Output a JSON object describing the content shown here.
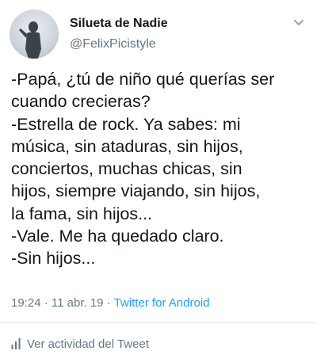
{
  "tweet": {
    "author": {
      "display_name": "Silueta de Nadie",
      "handle": "@FelixPicistyle",
      "avatar_icon": "silhouette-avatar"
    },
    "menu_icon": "chevron-down-icon",
    "text_lines": [
      "-Papá, ¿tú de niño qué querías ser",
      "cuando crecieras?",
      "-Estrella de rock. Ya sabes: mi",
      "música, sin ataduras, sin hijos,",
      "conciertos, muchas chicas, sin",
      "hijos, siempre viajando, sin hijos,",
      "la fama, sin hijos...",
      "-Vale. Me ha quedado claro.",
      "-Sin hijos..."
    ],
    "meta": {
      "time": "19:24",
      "separator": " · ",
      "date": "11 abr. 19",
      "source": "Twitter for Android"
    },
    "activity": {
      "icon": "bar-chart-icon",
      "label": "Ver actividad del Tweet"
    }
  },
  "colors": {
    "text": "#14171a",
    "secondary": "#657786",
    "link": "#1da1f2",
    "divider": "#e1e8ed"
  }
}
